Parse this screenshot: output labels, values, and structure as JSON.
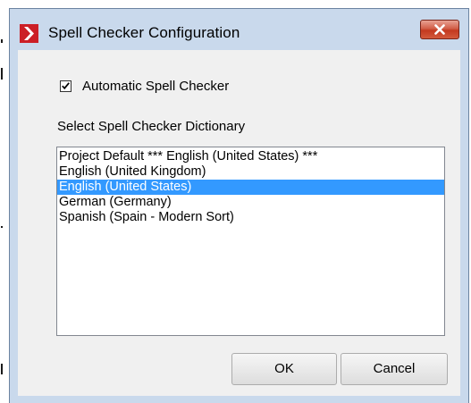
{
  "window": {
    "title": "Spell Checker Configuration",
    "app_icon": "red-chevron-icon",
    "close_icon": "close-x-icon",
    "accent_close": "#c7402a",
    "frame_color": "#c9d9ec"
  },
  "options": {
    "auto_spell_label": "Automatic Spell Checker",
    "auto_spell_checked": true
  },
  "dictionary": {
    "label": "Select Spell Checker Dictionary",
    "selected": "English (United States)",
    "selection_color": "#3399ff",
    "items": [
      "Project Default *** English (United States) ***",
      "English (United Kingdom)",
      "English (United States)",
      "German (Germany)",
      "Spanish (Spain - Modern Sort)"
    ]
  },
  "buttons": {
    "ok": "OK",
    "cancel": "Cancel"
  }
}
